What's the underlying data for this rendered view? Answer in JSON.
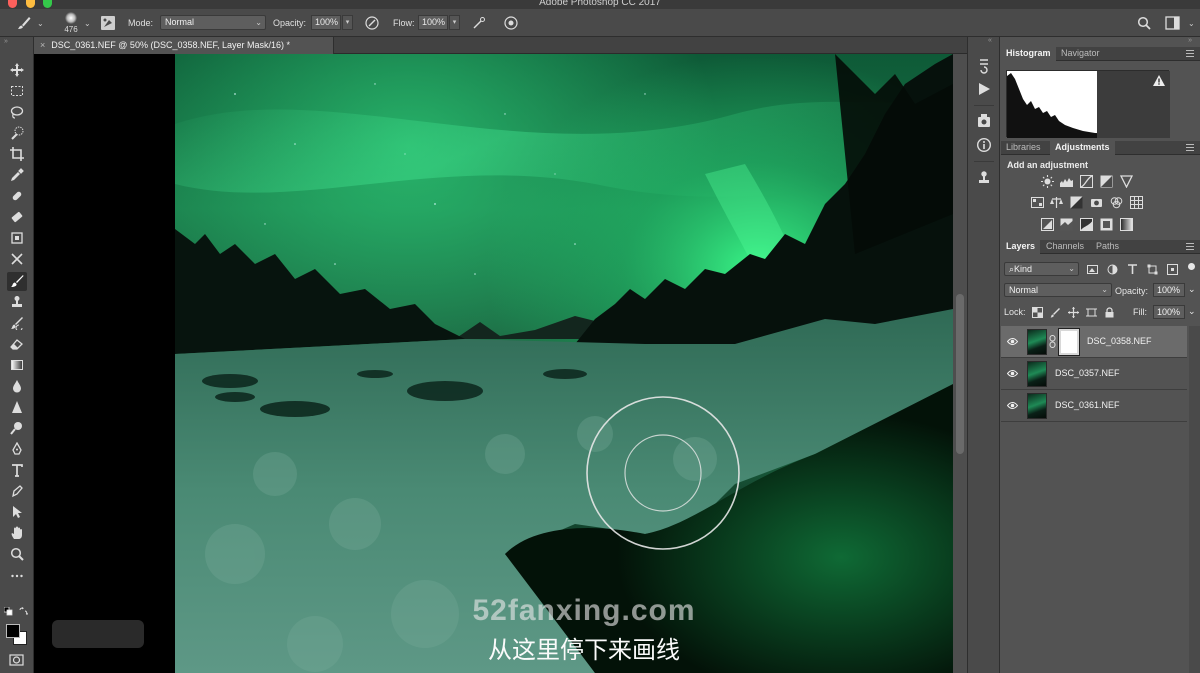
{
  "window": {
    "title": "Adobe Photoshop CC 2017"
  },
  "options_bar": {
    "brush_size": "476",
    "mode_label": "Mode:",
    "mode_value": "Normal",
    "opacity_label": "Opacity:",
    "opacity_value": "100%",
    "flow_label": "Flow:",
    "flow_value": "100%"
  },
  "document": {
    "tab_title": "DSC_0361.NEF @ 50% (DSC_0358.NEF, Layer Mask/16) *",
    "close_glyph": "×"
  },
  "canvas": {
    "watermark": "52fanxing.com",
    "subtitle": "从这里停下来画线"
  },
  "panels": {
    "top_tabs": [
      "Histogram",
      "Navigator"
    ],
    "mid_tabs": [
      "Libraries",
      "Adjustments"
    ],
    "adjustments_title": "Add an adjustment",
    "layer_tabs": [
      "Layers",
      "Channels",
      "Paths"
    ],
    "kind_filter": "Kind",
    "blend_mode": "Normal",
    "opacity_label": "Opacity:",
    "opacity_value": "100%",
    "lock_label": "Lock:",
    "fill_label": "Fill:",
    "fill_value": "100%"
  },
  "layers": [
    {
      "name": "DSC_0358.NEF",
      "selected": true,
      "has_mask": true
    },
    {
      "name": "DSC_0357.NEF",
      "selected": false,
      "has_mask": false
    },
    {
      "name": "DSC_0361.NEF",
      "selected": false,
      "has_mask": false
    }
  ],
  "colors": {
    "aurora": "#2ee07a",
    "panel_bg": "#535353",
    "toolbar_bg": "#4a4a4a",
    "foreground": "#000000",
    "background": "#ffffff"
  }
}
